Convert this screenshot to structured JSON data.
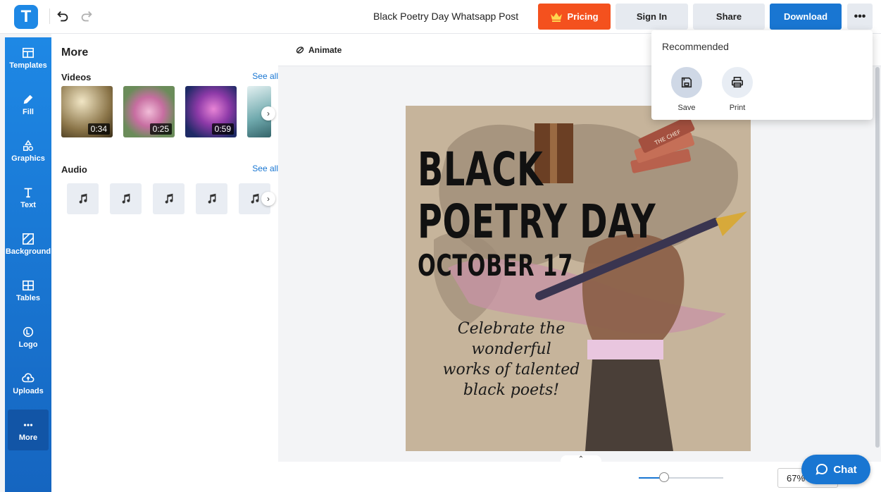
{
  "app": {
    "logo_letter": "T",
    "doc_title": "Black Poetry Day Whatsapp Post"
  },
  "topbar": {
    "pricing_label": "Pricing",
    "signin_label": "Sign In",
    "share_label": "Share",
    "download_label": "Download",
    "more_label": "•••"
  },
  "rail": {
    "items": [
      {
        "label": "Templates",
        "icon": "templates-icon"
      },
      {
        "label": "Fill",
        "icon": "pencil-icon"
      },
      {
        "label": "Graphics",
        "icon": "shapes-icon"
      },
      {
        "label": "Text",
        "icon": "text-icon"
      },
      {
        "label": "Background",
        "icon": "background-icon"
      },
      {
        "label": "Tables",
        "icon": "table-icon"
      },
      {
        "label": "Logo",
        "icon": "logo-icon"
      },
      {
        "label": "Uploads",
        "icon": "cloud-upload-icon"
      },
      {
        "label": "More",
        "icon": "dots-icon",
        "active": true
      }
    ]
  },
  "panel": {
    "title": "More",
    "videos": {
      "title": "Videos",
      "see_all": "See all",
      "items": [
        {
          "duration": "0:34",
          "color_a": "#d8c9a3",
          "color_b": "#4a3c22"
        },
        {
          "duration": "0:25",
          "color_a": "#b9c9a0",
          "color_b": "#d38ab5"
        },
        {
          "duration": "0:59",
          "color_a": "#2a3470",
          "color_b": "#c44fb0"
        },
        {
          "duration": "",
          "color_a": "#cfe3e6",
          "color_b": "#4f8d94"
        }
      ]
    },
    "audio": {
      "title": "Audio",
      "see_all": "See all",
      "count": 5
    }
  },
  "toolbar": {
    "animate_label": "Animate"
  },
  "poster": {
    "line1": "BLACK",
    "line2": "POETRY DAY",
    "line3": "OCTOBER 17",
    "script_line1": "Celebrate the",
    "script_line2": "wonderful",
    "script_line3": "works of talented",
    "script_line4": "black poets!",
    "book_label": "THE CHEF",
    "colors": {
      "bg": "#c6b49b",
      "map": "#9c8b76",
      "pink": "#c793a6",
      "skin": "#8a5e47"
    }
  },
  "dropdown": {
    "title": "Recommended",
    "save_label": "Save",
    "print_label": "Print"
  },
  "zoom": {
    "value": "67%",
    "level": 0.3
  },
  "chat": {
    "label": "Chat"
  }
}
